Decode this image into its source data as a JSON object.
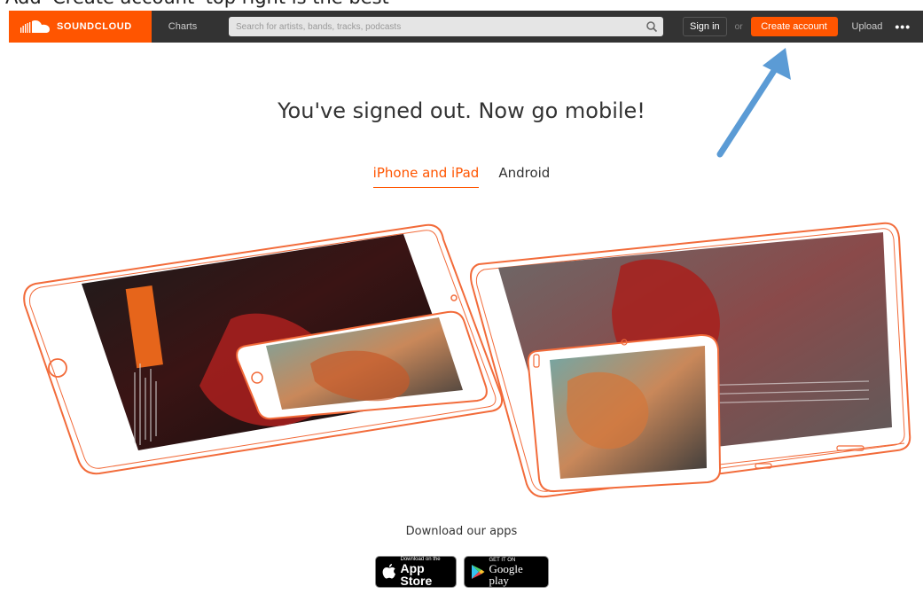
{
  "caption": {
    "text": "Add 'Create account' top right is the best"
  },
  "header": {
    "logo_text": "SOUNDCLOUD",
    "nav_charts": "Charts",
    "search_placeholder": "Search for artists, bands, tracks, podcasts",
    "signin_label": "Sign in",
    "or_label": "or",
    "create_label": "Create account",
    "upload_label": "Upload",
    "more_label": "•••"
  },
  "main": {
    "headline": "You've signed out. Now go mobile!",
    "tabs": [
      {
        "label": "iPhone and iPad",
        "active": true
      },
      {
        "label": "Android",
        "active": false
      }
    ]
  },
  "footer": {
    "download_label": "Download our apps",
    "app_store": {
      "small": "Download on the",
      "big": "App Store"
    },
    "google_play": {
      "small": "GET IT ON",
      "big": "Google play"
    }
  },
  "colors": {
    "accent": "#ff5500",
    "header_bg": "#333333",
    "annotation_arrow": "#5b9bd5"
  }
}
